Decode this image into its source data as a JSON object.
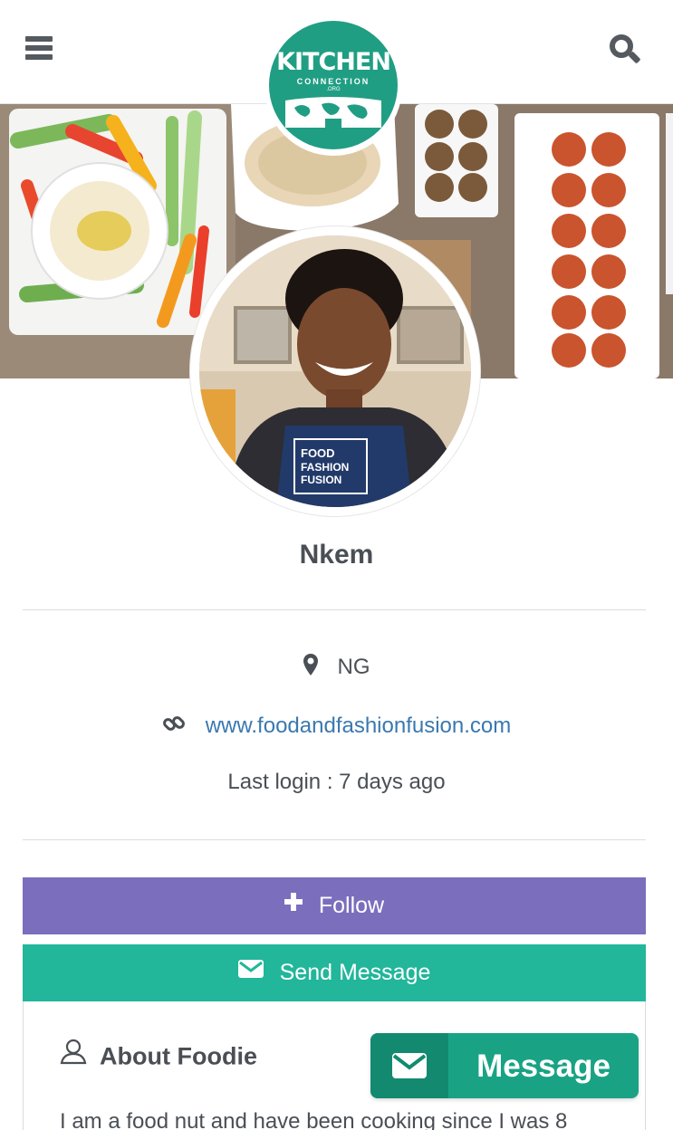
{
  "header": {
    "menu_icon": "hamburger-menu-icon",
    "search_icon": "search-icon",
    "logo": {
      "title": "KITCHEN",
      "subtitle": "CONNECTION",
      "suffix": ".ORG",
      "color": "#1f9e83"
    }
  },
  "profile": {
    "name": "Nkem",
    "location": "NG",
    "website": "www.foodandfashionfusion.com",
    "last_login": "Last login : 7 days ago",
    "apron_text": "FOOD FASHION FUSION"
  },
  "actions": {
    "follow_label": "Follow",
    "follow_color": "#7b6ebd",
    "send_message_label": "Send Message",
    "send_message_color": "#22b69b"
  },
  "about": {
    "heading": "About Foodie",
    "text": "I am a food nut and have been cooking since I was 8"
  },
  "floating_button": {
    "label": "Message",
    "color": "#19a384"
  }
}
